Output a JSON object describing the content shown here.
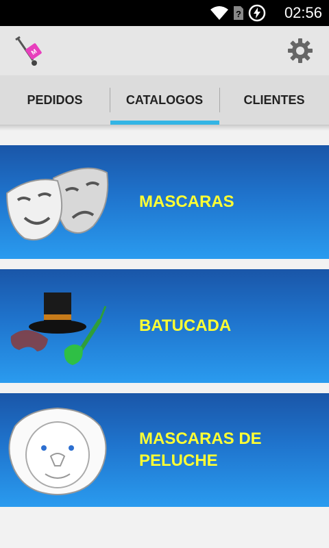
{
  "status_bar": {
    "time": "02:56"
  },
  "action_bar": {
    "app_icon": "hand-truck-icon",
    "settings_icon": "gear-icon"
  },
  "tabs": [
    {
      "label": "PEDIDOS",
      "selected": false
    },
    {
      "label": "CATALOGOS",
      "selected": true
    },
    {
      "label": "CLIENTES",
      "selected": false
    }
  ],
  "accent_color": "#33b5e5",
  "catalog": [
    {
      "label": "MASCARAS",
      "image": "theater-masks"
    },
    {
      "label": "BATUCADA",
      "image": "top-hat-mask-guitar"
    },
    {
      "label": "MASCARAS DE PELUCHE",
      "image": "lion-mask"
    }
  ]
}
